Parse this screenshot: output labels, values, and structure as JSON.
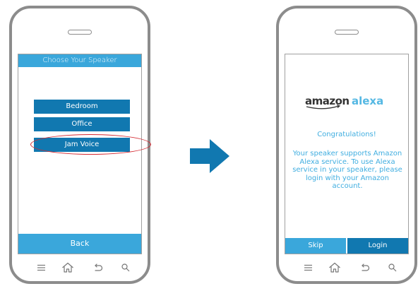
{
  "colors": {
    "phone_frame": "#8c8c8c",
    "header_blue": "#3aa7db",
    "button_dark_blue": "#1178b0",
    "highlight_red": "#d42a32",
    "arrow_blue": "#1178b0",
    "text_blue": "#41aee0"
  },
  "left_phone": {
    "header_title": "Choose Your Speaker",
    "options": [
      {
        "label": "Bedroom"
      },
      {
        "label": "Office"
      },
      {
        "label": "Jam Voice",
        "highlighted": true
      }
    ],
    "back_label": "Back",
    "nav_icons": [
      "menu-icon",
      "home-icon",
      "back-arrow-icon",
      "search-icon"
    ]
  },
  "right_phone": {
    "logo": {
      "brand": "amazon",
      "product": "alexa"
    },
    "congrats": "Congratulations!",
    "message": "Your speaker supports Amazon Alexa service. To use Alexa service in your speaker, please login with your Amazon account.",
    "skip_label": "Skip",
    "login_label": "Login",
    "nav_icons": [
      "menu-icon",
      "home-icon",
      "back-arrow-icon",
      "search-icon"
    ]
  },
  "flow_arrow": "right-arrow-icon"
}
